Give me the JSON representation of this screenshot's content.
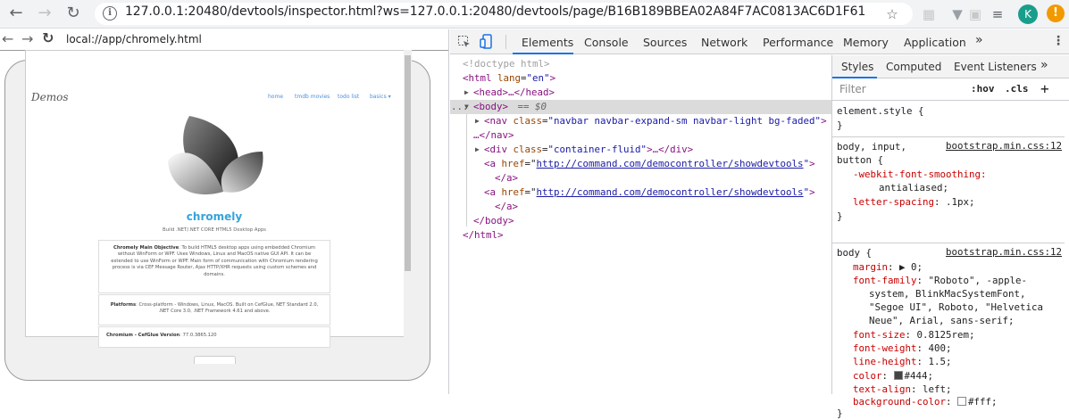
{
  "browser": {
    "url": "127.0.0.1:20480/devtools/inspector.html?ws=127.0.0.1:20480/devtools/page/B16B189BBEA02A84F7AC0813AC6D1F61",
    "avatar_letter": "K",
    "update_badge": "!"
  },
  "app": {
    "url": "local://app/chromely.html",
    "brand": "Demos",
    "nav": [
      "home",
      "tmdb movies",
      "todo list",
      "basics ▾"
    ],
    "title": "chromely",
    "subtitle": "Build .NET/.NET CORE HTML5 Desktop Apps",
    "objective_label": "Chromely Main Objective",
    "objective_text": ": To build HTML5 desktop apps using embedded Chromium without WinForm or WPF. Uses Windows, Linux and MacOS native GUI API. It can be extended to use WinForm or WPF. Main form of communication with Chromium rendering process is via CEF Message Router, Ajax HTTP/XHR requests using custom schemes and domains.",
    "platforms_label": "Platforms",
    "platforms_text": ": Cross-platform - Windows, Linux, MacOS. Built on CefGlue, NET Standard 2.0, .NET Core 3.0, .NET Framework 4.61 and above.",
    "version_label": "Chromium - CefGlue Version",
    "version_text": ": 77.0.3865.120"
  },
  "devtools": {
    "tabs": [
      "Elements",
      "Console",
      "Sources",
      "Network",
      "Performance",
      "Memory",
      "Application"
    ],
    "more": "»",
    "elements": {
      "doctype": "<!doctype html>",
      "html_open_tag": "<html ",
      "html_lang_attr": "lang",
      "html_lang_val": "\"en\"",
      "head": "<head>…</head>",
      "body_open": "<body>",
      "body_marker": " == $0",
      "nav_tag": "<nav ",
      "nav_attr": "class",
      "nav_val": "\"navbar navbar-expand-sm navbar-light bg-faded\"",
      "nav_close": "…</nav>",
      "div_tag": "<div ",
      "div_attr": "class",
      "div_val": "\"container-fluid\"",
      "div_close": ">…</div>",
      "a_tag": "<a ",
      "a_attr": "href",
      "a_href": "http://command.com/democontroller/showdevtools",
      "a_close": "</a>",
      "body_close": "</body>",
      "html_close": "</html>",
      "ellipsis": "..."
    },
    "styles": {
      "subtabs": [
        "Styles",
        "Computed",
        "Event Listeners"
      ],
      "filter_placeholder": "Filter",
      "hov": ":hov",
      "cls": ".cls",
      "plus": "+",
      "element_style": "element.style {",
      "close_brace": "}",
      "rule1_selector": "body, input,",
      "rule1_selector2": "button {",
      "rule1_source": "bootstrap.min.css:12",
      "rule1_p1": "-webkit-font-smoothing:",
      "rule1_v1": "antialiased;",
      "rule1_p2": "letter-spacing",
      "rule1_v2": ": .1px;",
      "rule2_selector": "body {",
      "rule2_source": "bootstrap.min.css:12",
      "margin_p": "margin",
      "margin_v": ": ▶ 0;",
      "ff_p": "font-family",
      "ff_v1": ": \"Roboto\", -apple-",
      "ff_v2": "system, BlinkMacSystemFont,",
      "ff_v3": "\"Segoe UI\", Roboto, \"Helvetica",
      "ff_v4": "Neue\", Arial, sans-serif;",
      "fs_p": "font-size",
      "fs_v": ": 0.8125rem;",
      "fw_p": "font-weight",
      "fw_v": ": 400;",
      "lh_p": "line-height",
      "lh_v": ": 1.5;",
      "color_p": "color",
      "color_v": "#444;",
      "ta_p": "text-align",
      "ta_v": ": left;",
      "bg_p": "background-color",
      "bg_v": "#fff;",
      "color_swatch": "#444444",
      "bg_swatch": "#ffffff"
    }
  }
}
